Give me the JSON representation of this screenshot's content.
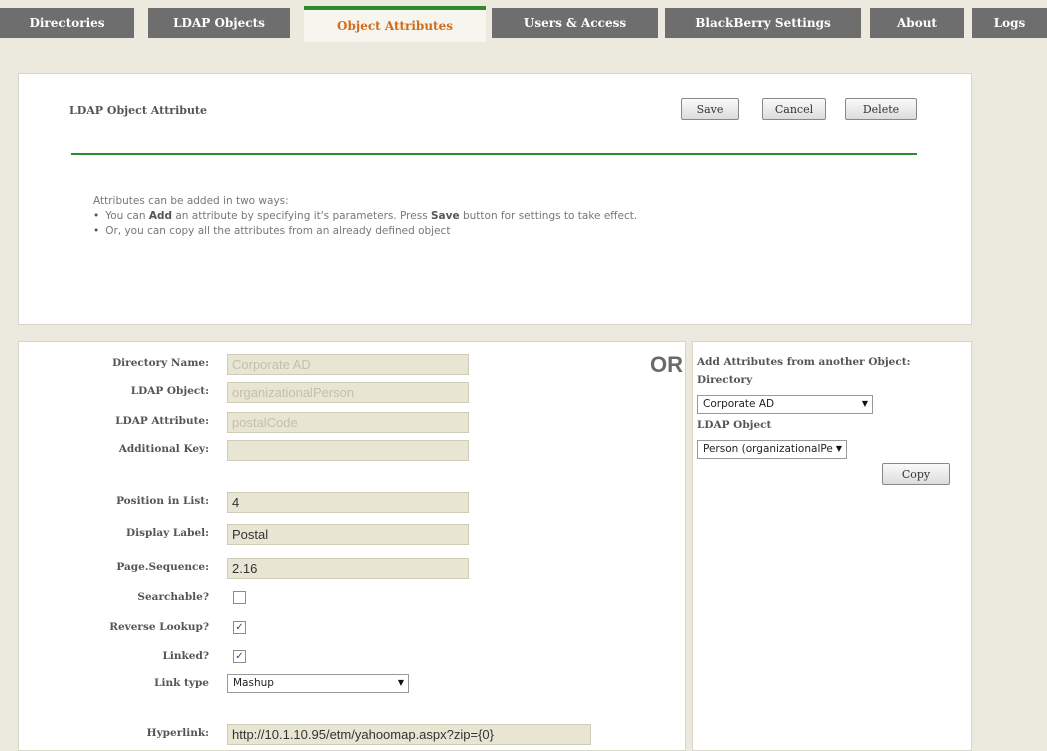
{
  "tabs": [
    {
      "label": "Directories"
    },
    {
      "label": "LDAP Objects"
    },
    {
      "label": "Object Attributes",
      "active": true
    },
    {
      "label": "Users & Access"
    },
    {
      "label": "BlackBerry Settings"
    },
    {
      "label": "About"
    },
    {
      "label": "Logs"
    }
  ],
  "header": {
    "title": "LDAP Object Attribute",
    "save_label": "Save",
    "cancel_label": "Cancel",
    "delete_label": "Delete"
  },
  "info": {
    "intro": "Attributes can be added in two ways:",
    "line1_a": "You can ",
    "line1_b": "Add",
    "line1_c": " an attribute by specifying it's parameters. Press ",
    "line1_d": "Save",
    "line1_e": " button for settings to take effect.",
    "line2": "Or, you can copy all the attributes from an already defined object"
  },
  "form": {
    "directory_name": {
      "label": "Directory Name:",
      "value": "Corporate AD"
    },
    "ldap_object": {
      "label": "LDAP Object:",
      "value": "organizationalPerson"
    },
    "ldap_attribute": {
      "label": "LDAP Attribute:",
      "value": "postalCode"
    },
    "additional_key": {
      "label": "Additional Key:",
      "value": ""
    },
    "position_in_list": {
      "label": "Position in List:",
      "value": "4"
    },
    "display_label": {
      "label": "Display Label:",
      "value": "Postal"
    },
    "page_sequence": {
      "label": "Page.Sequence:",
      "value": "2.16"
    },
    "searchable": {
      "label": "Searchable?",
      "checked": false
    },
    "reverse_lookup": {
      "label": "Reverse Lookup?",
      "checked": true
    },
    "linked": {
      "label": "Linked?",
      "checked": true
    },
    "link_type": {
      "label": "Link type",
      "value": "Mashup"
    },
    "hyperlink": {
      "label": "Hyperlink:",
      "value": "http://10.1.10.95/etm/yahoomap.aspx?zip={0}"
    }
  },
  "copy_panel": {
    "or_label": "OR",
    "heading": "Add Attributes from another Object:",
    "directory_label": "Directory",
    "directory_value": "Corporate AD",
    "ldap_object_label": "LDAP Object",
    "ldap_object_value": "Person (organizationalPe",
    "copy_label": "Copy"
  },
  "colors": {
    "active_tab_text": "#d16a1a",
    "accent_green": "#2f8a2f",
    "tab_bg": "#6e6e6e"
  }
}
